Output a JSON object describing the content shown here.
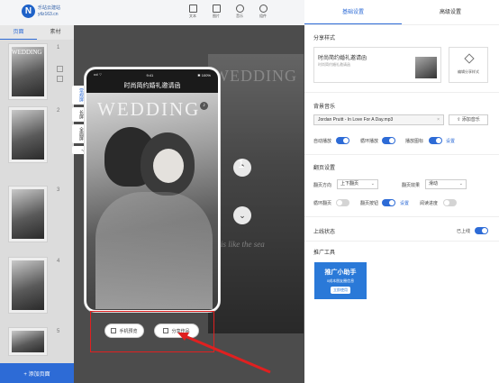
{
  "topbar": {
    "logo_mark": "N",
    "logo_lines": [
      "乐站云建站",
      "ytlz163.cn"
    ],
    "items": [
      {
        "label": "文本",
        "icon": "text-icon"
      },
      {
        "label": "图片",
        "icon": "image-icon"
      },
      {
        "label": "音乐",
        "icon": "music-icon"
      },
      {
        "label": "组件",
        "icon": "component-icon"
      }
    ]
  },
  "left_panel": {
    "tabs": [
      "页面",
      "素材"
    ],
    "thumb_word": "WEDDING",
    "page_numbers": [
      "1",
      "2",
      "3",
      "4",
      "5"
    ],
    "add_page": "+ 添加页面"
  },
  "canvas": {
    "side_tabs": [
      "常规屏",
      "长屏",
      "全面屏",
      "?"
    ],
    "bg_word": "WEDDING",
    "bg_script": "is like the sea",
    "phone": {
      "status_left": "•ııl ⌔",
      "status_time": "9:41",
      "status_right": "✱ 100%",
      "title": "时尚简约婚礼邀请函",
      "photo_word": "WEDDING"
    },
    "page_indicator": "1",
    "nav_up": "⌃",
    "nav_down": "⌄",
    "actions": {
      "preview": "手机预览",
      "share": "分享作品"
    }
  },
  "right_panel": {
    "tabs": [
      "基础设置",
      "高级设置"
    ],
    "share_style": {
      "title": "分享样式",
      "card_title": "时尚简约婚礼邀请函",
      "card_desc": "时尚简约婚礼邀请函",
      "edit_label": "编辑分享样式"
    },
    "bg_music": {
      "title": "背景音乐",
      "file": "Jordan Pruitt - In Love For A Day.mp3",
      "clear": "×",
      "add": "添加音乐",
      "autoplay": "自动播放",
      "loop": "循环播放",
      "play_icon": "播放图标",
      "settings": "设置"
    },
    "page_flip": {
      "title": "翻页设置",
      "direction_label": "翻页方向",
      "direction_value": "上下翻页",
      "effect_label": "翻页效果",
      "effect_value": "滑动",
      "loop_label": "循环翻页",
      "button_label": "翻页按钮",
      "settings": "设置",
      "lock_label": "阅读进度"
    },
    "publish": {
      "title": "上线状态",
      "status": "已上线"
    },
    "promo_tools": {
      "title": "推广工具",
      "banner_title": "推广小助手",
      "banner_sub": "0成本朋友圈信息",
      "banner_btn": "立即使用"
    }
  }
}
